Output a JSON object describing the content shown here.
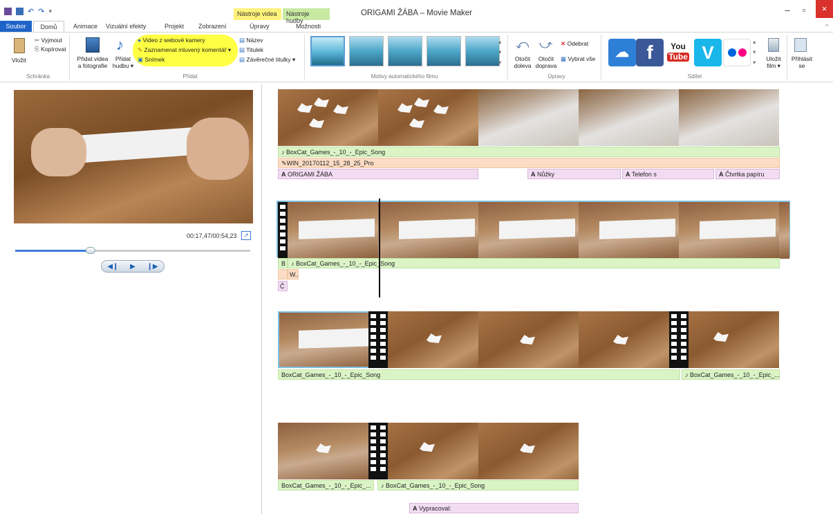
{
  "window": {
    "title": "ORIGAMI ŽÁBA – Movie Maker",
    "context_tabs": {
      "video": "Nástroje videa",
      "music": "Nástroje hudby"
    },
    "controls": {
      "minimize": "–",
      "restore": "▫",
      "close": "×"
    }
  },
  "tabs": [
    "Soubor",
    "Domů",
    "Animace",
    "Vizuální efekty",
    "Projekt",
    "Zobrazení",
    "Úpravy",
    "Možnosti"
  ],
  "ribbon": {
    "clipboard": {
      "paste": "Vložit",
      "cut": "Vyjmout",
      "copy": "Kopírovat",
      "label": "Schránka"
    },
    "add": {
      "add_video_photo_1": "Přidat videa",
      "add_video_photo_2": "a fotografie",
      "add_music_1": "Přidat",
      "add_music_2": "hudbu",
      "webcam": "Video z webové kamery",
      "narration": "Zaznamenat mluvený komentář",
      "snapshot": "Snímek",
      "title": "Název",
      "caption": "Titulek",
      "credits": "Závěrečné titulky",
      "label": "Přidat"
    },
    "themes": {
      "label": "Motivy automatického filmu"
    },
    "editing": {
      "rotate_left_1": "Otočit",
      "rotate_left_2": "doleva",
      "rotate_right_1": "Otočit",
      "rotate_right_2": "doprava",
      "remove": "Odebrat",
      "select_all": "Vybrat vše",
      "label": "Úpravy"
    },
    "share": {
      "label": "Sdílet",
      "youtube_1": "You",
      "youtube_2": "Tube",
      "save_movie_1": "Uložit",
      "save_movie_2": "film",
      "sign_in_1": "Přihlásit",
      "sign_in_2": "se"
    }
  },
  "preview": {
    "time": "00:17,47/00:54,23",
    "progress": 0.32
  },
  "storyboard": {
    "row1": {
      "music": "BoxCat_Games_-_10_-_Epic_Song",
      "narration": "WIN_20170112_15_28_25_Pro",
      "title_main": "ORIGAMI ŽÁBA",
      "caption_1": "Nůžky",
      "caption_2": "Telefon s",
      "caption_3": "Čtvrtka papíru"
    },
    "row2": {
      "music_short": "B",
      "music": "BoxCat_Games_-_10_-_Epic_Song",
      "narration": "W...",
      "caption": "Č"
    },
    "row3": {
      "music_1": "BoxCat_Games_-_10_-_Epic_Song",
      "music_2": "BoxCat_Games_-_10_-_Epic_..."
    },
    "row4": {
      "music_1": "BoxCat_Games_-_10_-_Epic_...",
      "music_2": "BoxCat_Games_-_10_-_Epic_Song",
      "credits": "Vypracoval:"
    }
  }
}
